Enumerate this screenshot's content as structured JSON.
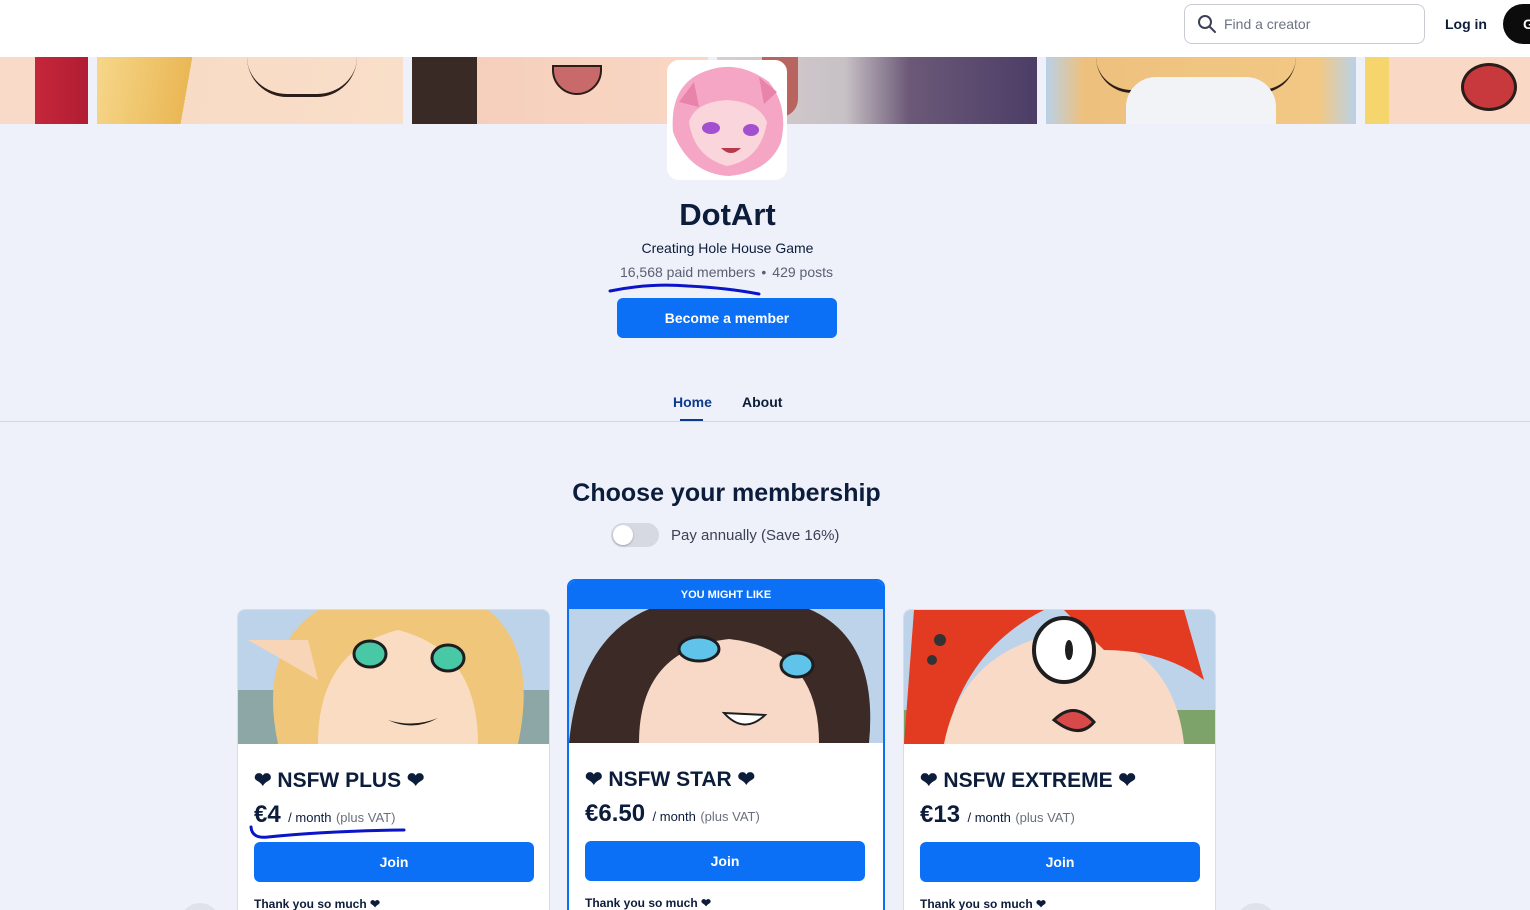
{
  "header": {
    "search_placeholder": "Find a creator",
    "login_label": "Log in",
    "signup_label": "G",
    "search_icon": "search-icon"
  },
  "creator": {
    "name": "DotArt",
    "tagline": "Creating Hole House Game",
    "paid_members": "16,568 paid members",
    "separator": "•",
    "posts": "429 posts",
    "become_label": "Become a member"
  },
  "tabs": [
    {
      "label": "Home",
      "active": true
    },
    {
      "label": "About",
      "active": false
    }
  ],
  "membership": {
    "heading": "Choose your membership",
    "toggle_label": "Pay annually (Save 16%)",
    "toggle_on": false,
    "tiers": [
      {
        "name": "❤ NSFW PLUS ❤",
        "price": "€4",
        "per": "/ month",
        "vat": "(plus VAT)",
        "join_label": "Join",
        "note": "Thank you so much ❤",
        "badge": ""
      },
      {
        "name": "❤ NSFW STAR ❤",
        "price": "€6.50",
        "per": "/ month",
        "vat": "(plus VAT)",
        "join_label": "Join",
        "note": "Thank you so much ❤",
        "badge": "YOU MIGHT LIKE"
      },
      {
        "name": "❤ NSFW EXTREME ❤",
        "price": "€13",
        "per": "/ month",
        "vat": "(plus VAT)",
        "join_label": "Join",
        "note": "Thank you so much ❤",
        "badge": ""
      }
    ]
  },
  "colors": {
    "accent": "#0b70f6",
    "page_bg": "#eff1fa",
    "text": "#0c1c3b",
    "annotation_ink": "#0a14c8"
  }
}
